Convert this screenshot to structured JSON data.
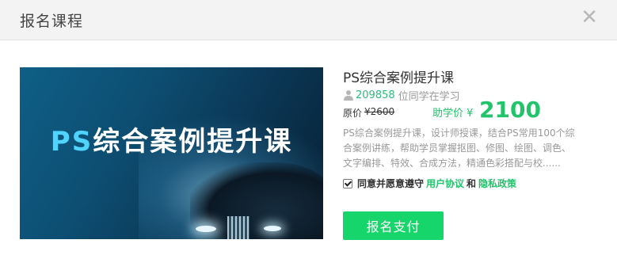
{
  "dialog": {
    "title": "报名课程",
    "close_symbol": "✕"
  },
  "banner": {
    "title_prefix": "PS",
    "title_rest": "综合案例提升课"
  },
  "course": {
    "title": "PS综合案例提升课",
    "learner_count": "209858",
    "learner_text": "位同学在学习",
    "original_label": "原价",
    "original_price": "¥2600",
    "help_label": "助学价 ¥",
    "help_price": "2100",
    "description": "PS综合案例提升课，设计师授课，结合PS常用100个综合案例讲练，帮助学员掌握抠图、修图、绘图、调色、文字编排、特效、合成方法，精通色彩搭配与校......"
  },
  "agreement": {
    "checked": true,
    "text": "同意并愿意遵守",
    "user_agreement": "用户协议",
    "and": "和",
    "privacy_policy": "隐私政策"
  },
  "pay_button": {
    "label": "报名支付"
  },
  "colors": {
    "accent": "#21c46a",
    "button": "#16d56b",
    "learner_count": "#2ebb7c"
  },
  "icons": [
    "close-icon",
    "user-icon",
    "checkbox-icon"
  ]
}
